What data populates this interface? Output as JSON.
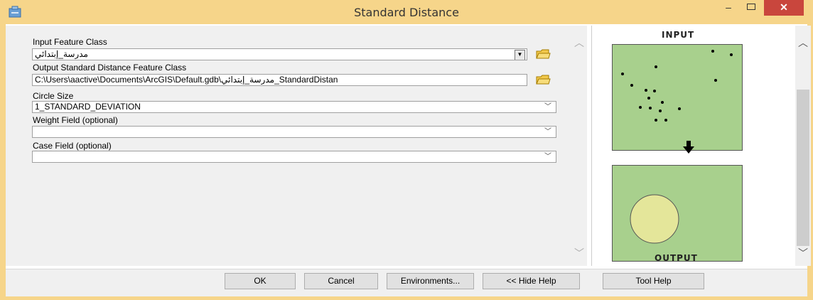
{
  "window": {
    "title": "Standard Distance",
    "minimize": "–",
    "maximize": "▭",
    "close": "✕"
  },
  "form": {
    "input_feature_class": {
      "label": "Input Feature Class",
      "value": "مدرسة_إبتدائي"
    },
    "output_feature_class": {
      "label": "Output Standard Distance Feature Class",
      "value": "C:\\Users\\aactive\\Documents\\ArcGIS\\Default.gdb\\مدرسة_إبتدائي_StandardDistan"
    },
    "circle_size": {
      "label": "Circle Size",
      "value": "1_STANDARD_DEVIATION"
    },
    "weight_field": {
      "label": "Weight Field (optional)",
      "value": ""
    },
    "case_field": {
      "label": "Case Field (optional)",
      "value": ""
    }
  },
  "help_panel": {
    "input_label": "INPUT",
    "output_label": "OUTPUT",
    "colors": {
      "map_fill": "#a8d08d",
      "circle_fill": "#e4e69a"
    }
  },
  "buttons": {
    "ok": "OK",
    "cancel": "Cancel",
    "environments": "Environments...",
    "hide_help": "<< Hide Help",
    "tool_help": "Tool Help"
  }
}
